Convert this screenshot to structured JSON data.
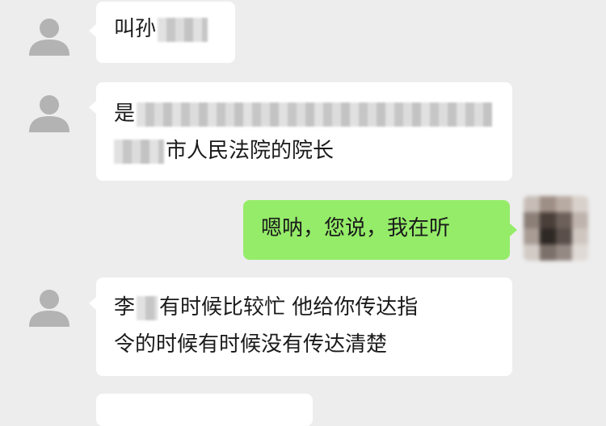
{
  "messages": [
    {
      "side": "left",
      "line1_prefix": "叫孙"
    },
    {
      "side": "left",
      "line1_prefix": "是",
      "line2_suffix": "市人民法院的院长"
    },
    {
      "side": "right",
      "text": "嗯呐，您说，我在听"
    },
    {
      "side": "left",
      "line1": "李",
      "line1_rest": "有时候比较忙  他给你传达指",
      "line2": "令的时候有时候没有传达清楚"
    }
  ],
  "icons": {
    "contact_avatar": "user-silhouette-icon",
    "self_avatar": "pixelated-avatar"
  },
  "colors": {
    "background": "#ededed",
    "incoming_bubble": "#ffffff",
    "outgoing_bubble": "#95ec69",
    "avatar_gray": "#b3b3b3"
  }
}
